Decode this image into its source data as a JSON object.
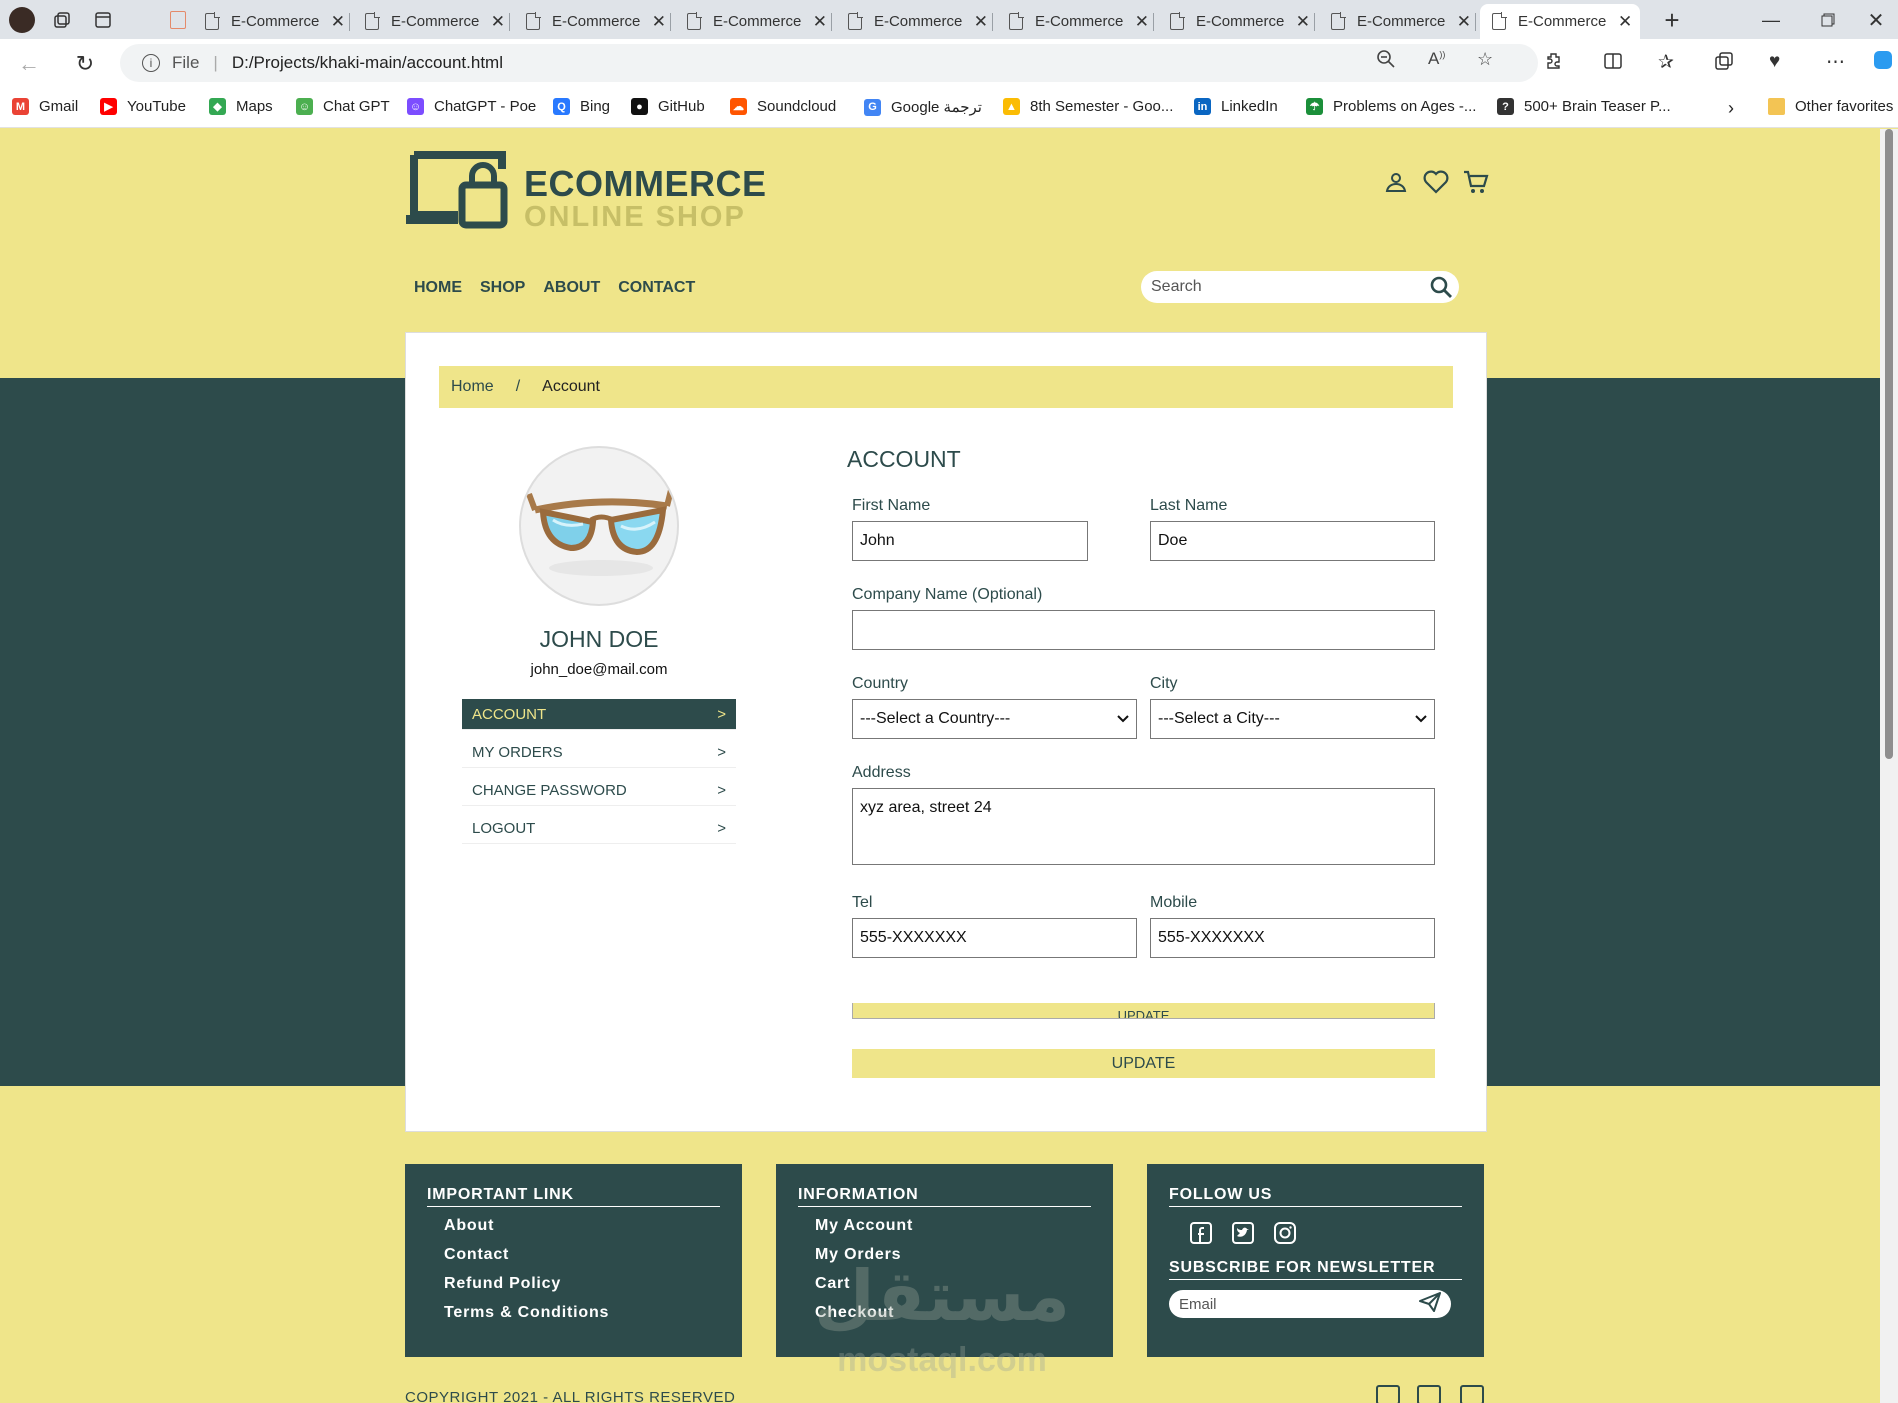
{
  "browser": {
    "tabs": [
      {
        "title": "E-Commerce"
      },
      {
        "title": "E-Commerce"
      },
      {
        "title": "E-Commerce"
      },
      {
        "title": "E-Commerce"
      },
      {
        "title": "E-Commerce"
      },
      {
        "title": "E-Commerce"
      },
      {
        "title": "E-Commerce"
      },
      {
        "title": "E-Commerce"
      },
      {
        "title": "E-Commerce"
      }
    ],
    "url_scheme": "File",
    "url": "D:/Projects/khaki-main/account.html",
    "bookmarks": [
      {
        "label": "Gmail",
        "color": "#ea4335",
        "glyph": "M"
      },
      {
        "label": "YouTube",
        "color": "#ff0000",
        "glyph": "▶"
      },
      {
        "label": "Maps",
        "color": "#34a853",
        "glyph": "◆"
      },
      {
        "label": "Chat GPT",
        "color": "#4caf50",
        "glyph": "☺"
      },
      {
        "label": "ChatGPT - Poe",
        "color": "#7c4dff",
        "glyph": "☺"
      },
      {
        "label": "Bing",
        "color": "#2979ff",
        "glyph": "Q"
      },
      {
        "label": "GitHub",
        "color": "#111111",
        "glyph": "●"
      },
      {
        "label": "Soundcloud",
        "color": "#ff5500",
        "glyph": "☁"
      },
      {
        "label": "Google ترجمة",
        "color": "#4285f4",
        "glyph": "G"
      },
      {
        "label": "8th Semester - Goo...",
        "color": "#fbbc04",
        "glyph": "▲"
      },
      {
        "label": "LinkedIn",
        "color": "#0a66c2",
        "glyph": "in"
      },
      {
        "label": "Problems on Ages -...",
        "color": "#1b8f3a",
        "glyph": "☂"
      },
      {
        "label": "500+ Brain Teaser P...",
        "color": "#333333",
        "glyph": "?"
      }
    ],
    "other_favorites": "Other favorites"
  },
  "site": {
    "logo_title": "ECOMMERCE",
    "logo_sub": "ONLINE SHOP",
    "nav": [
      "HOME",
      "SHOP",
      "ABOUT",
      "CONTACT"
    ],
    "search_placeholder": "Search",
    "brand_dark": "#2d4b4b",
    "brand_khaki": "#efe58a"
  },
  "breadcrumb": {
    "home": "Home",
    "separator": "/",
    "current": "Account"
  },
  "profile": {
    "name": "JOHN DOE",
    "email": "john_doe@mail.com",
    "menu": [
      {
        "label": "ACCOUNT",
        "arrow": ">",
        "active": true
      },
      {
        "label": "MY ORDERS",
        "arrow": ">"
      },
      {
        "label": "CHANGE PASSWORD",
        "arrow": ">"
      },
      {
        "label": "LOGOUT",
        "arrow": ">"
      }
    ]
  },
  "form": {
    "title": "ACCOUNT",
    "first_name_label": "First Name",
    "first_name_value": "John",
    "last_name_label": "Last Name",
    "last_name_value": "Doe",
    "company_label": "Company Name (Optional)",
    "company_value": "",
    "country_label": "Country",
    "country_value": "---Select a Country---",
    "city_label": "City",
    "city_value": "---Select a City---",
    "address_label": "Address",
    "address_value": "xyz area, street 24",
    "tel_label": "Tel",
    "tel_value": "555-XXXXXXX",
    "mobile_label": "Mobile",
    "mobile_value": "555-XXXXXXX",
    "update_ghost_label": "UPDATE",
    "update_label": "UPDATE"
  },
  "footer": {
    "important": {
      "title": "IMPORTANT LINK",
      "links": [
        "About",
        "Contact",
        "Refund Policy",
        "Terms & Conditions"
      ]
    },
    "information": {
      "title": "INFORMATION",
      "links": [
        "My Account",
        "My Orders",
        "Cart",
        "Checkout"
      ]
    },
    "follow": {
      "title": "FOLLOW US",
      "newsletter_title": "SUBSCRIBE FOR NEWSLETTER",
      "email_placeholder": "Email"
    },
    "copyright": "COPYRIGHT 2021 - ALL RIGHTS RESERVED"
  },
  "watermark": {
    "arabic": "مستقل",
    "latin": "mostaql.com"
  }
}
